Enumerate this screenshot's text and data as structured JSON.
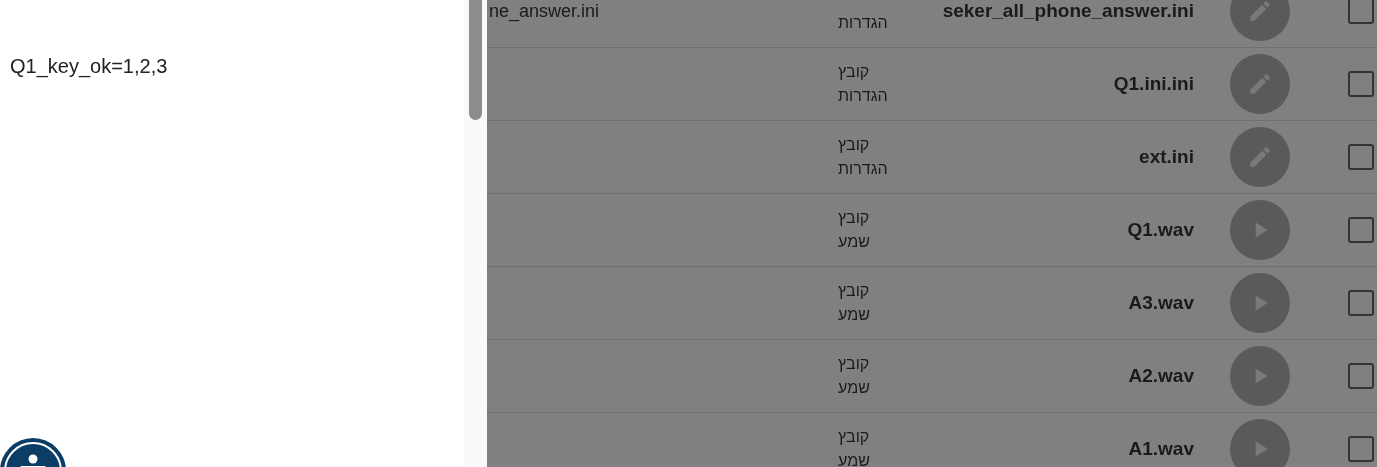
{
  "drawer": {
    "content": "Q1_key_ok=1,2,3"
  },
  "rows": [
    {
      "column_5": "ne_answer.ini",
      "type": "הגדרות",
      "name": "seker_all_phone_answer.ini",
      "kind": "edit",
      "checked": false
    },
    {
      "type": "קובץ הגדרות",
      "name": "Q1.ini.ini",
      "kind": "edit",
      "checked": false
    },
    {
      "type": "קובץ הגדרות",
      "name": "ext.ini",
      "kind": "edit",
      "checked": false
    },
    {
      "type": "קובץ שמע",
      "name": "Q1.wav",
      "kind": "play",
      "checked": false
    },
    {
      "type": "קובץ שמע",
      "name": "A3.wav",
      "kind": "play",
      "checked": false
    },
    {
      "type": "קובץ שמע",
      "name": "A2.wav",
      "kind": "play",
      "checked": false
    },
    {
      "type": "קובץ שמע",
      "name": "A1.wav",
      "kind": "play",
      "checked": false
    }
  ]
}
